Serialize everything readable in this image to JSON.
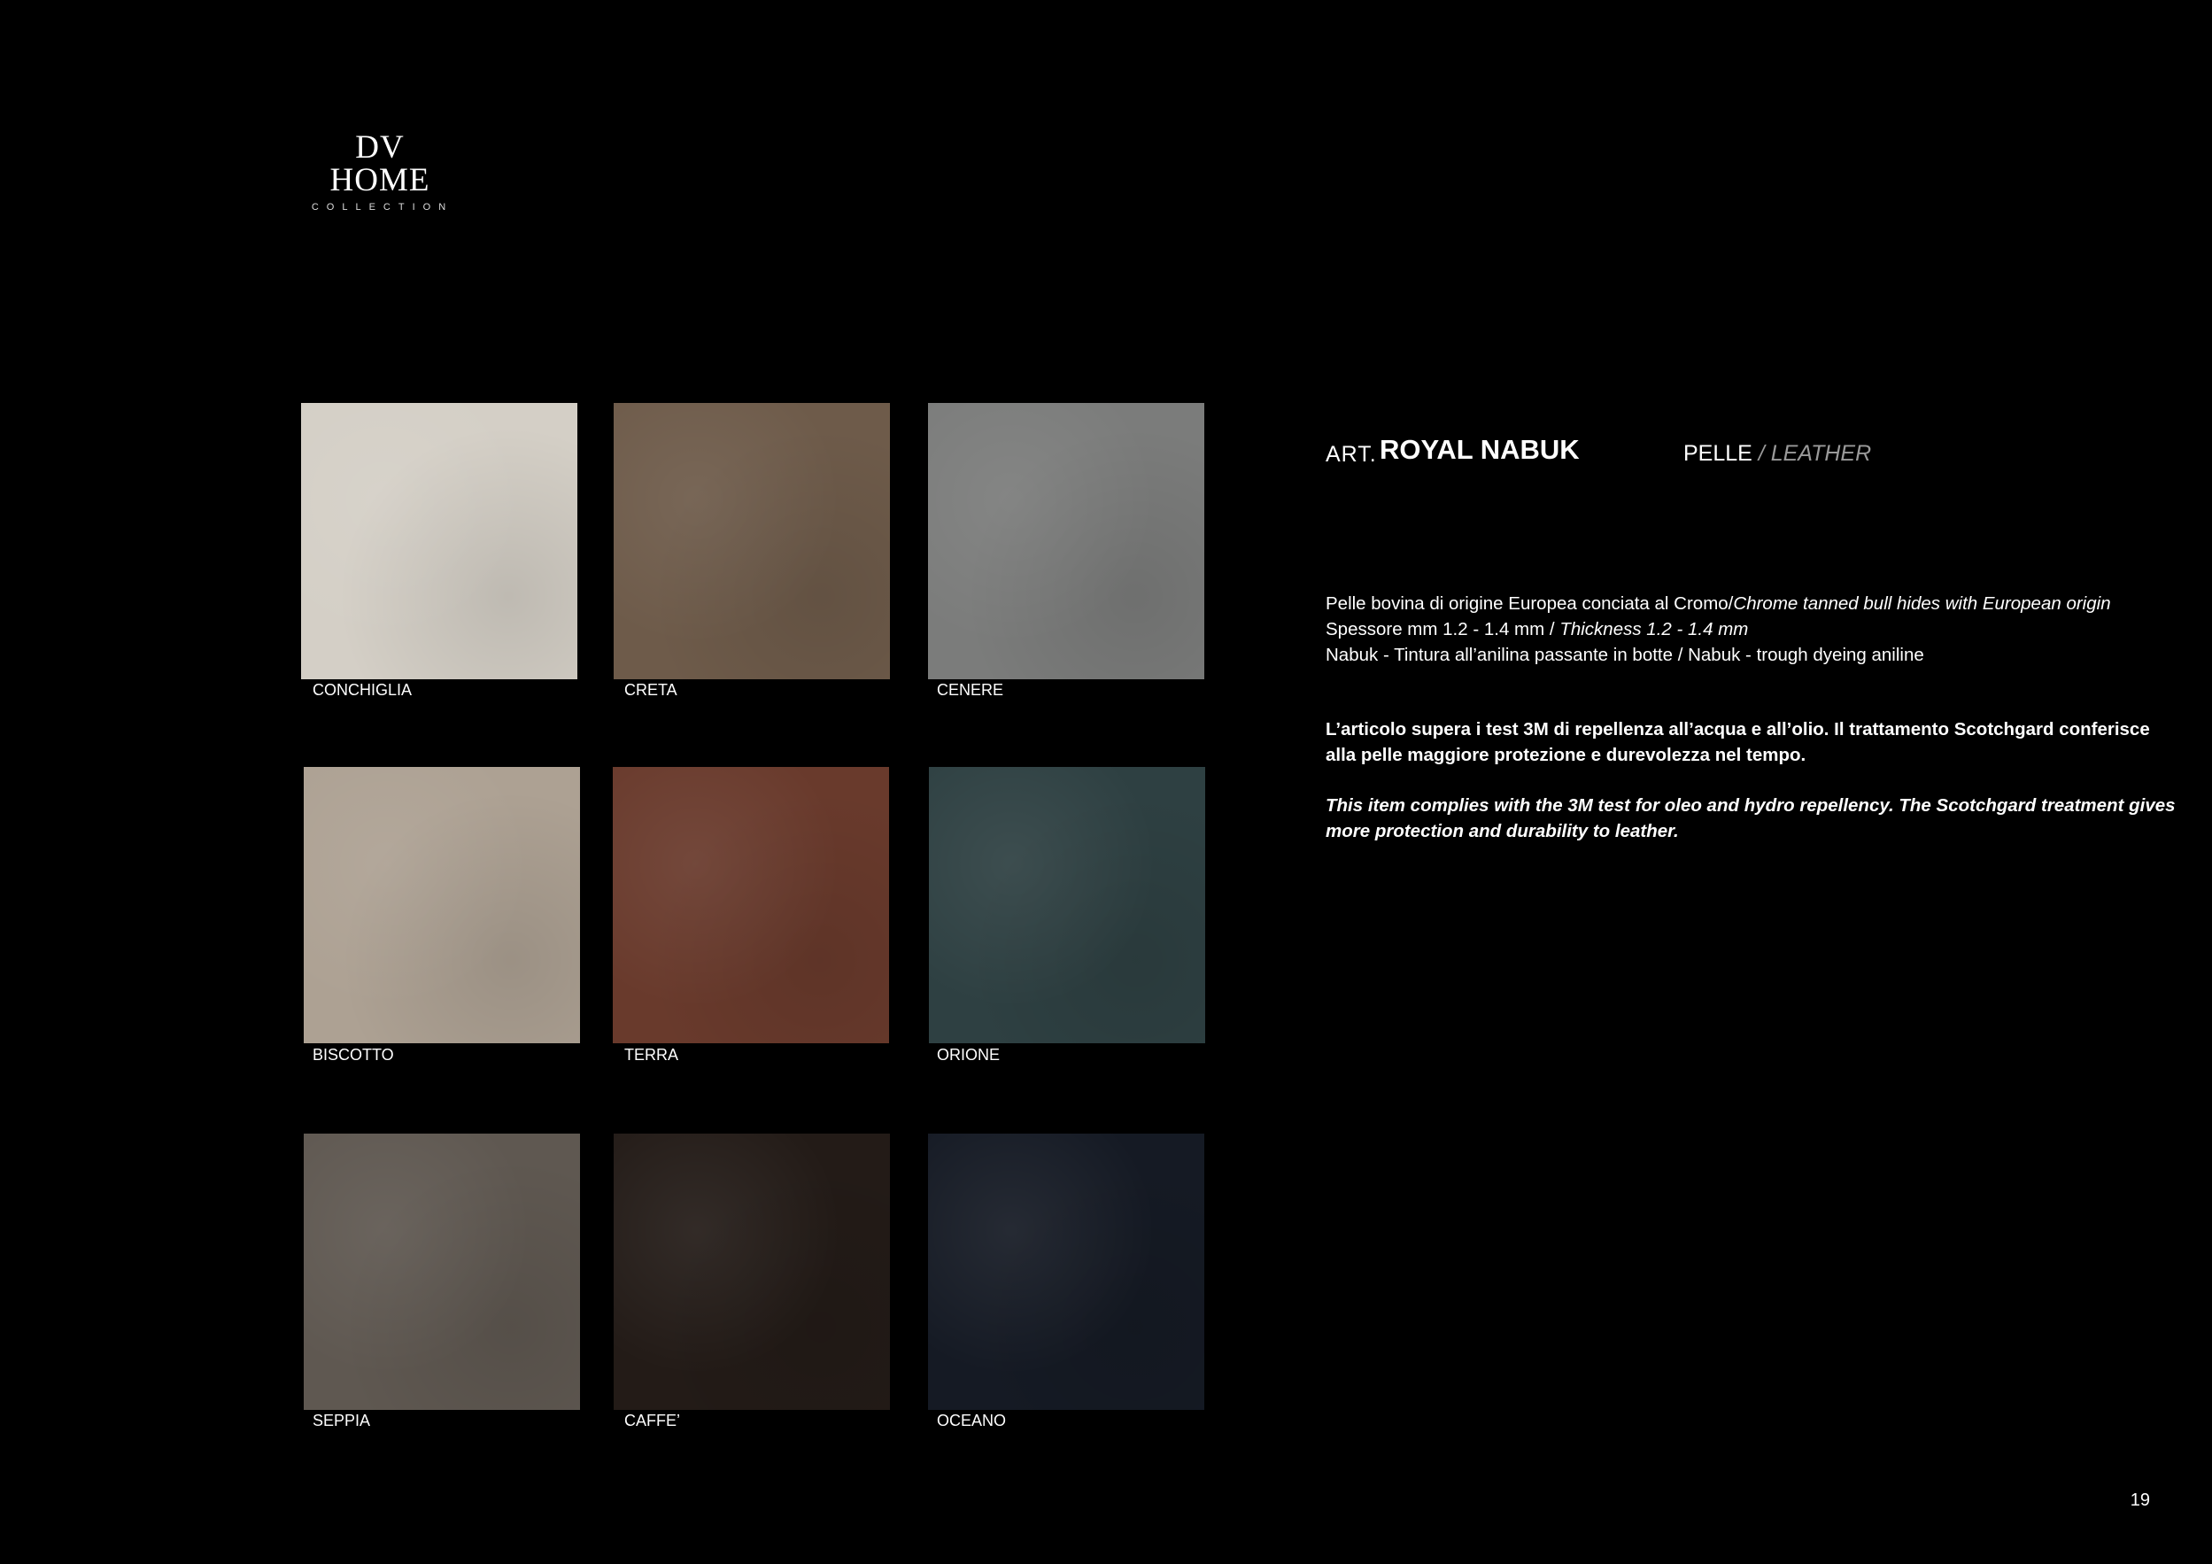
{
  "brand": {
    "name": "DV HOME",
    "subtitle": "COLLECTION"
  },
  "article": {
    "prefix": "ART.",
    "name": "ROYAL NABUK",
    "material_it": "PELLE",
    "material_sep": " / ",
    "material_en": "LEATHER"
  },
  "description": {
    "line1_it": "Pelle bovina di origine Europea conciata al Cromo/",
    "line1_en": "Chrome tanned bull hides with European origin",
    "line2_it": "Spessore mm 1.2 - 1.4 mm / ",
    "line2_en": "Thickness 1.2 - 1.4 mm",
    "line3": "Nabuk  - Tintura all’anilina passante in botte / Nabuk - trough dyeing aniline"
  },
  "treatment": {
    "it": "L’articolo supera i test 3M di repellenza all’acqua e all’olio. Il trattamento Scotchgard conferisce alla pelle maggiore protezione e durevolezza nel tempo.",
    "en": "This item complies with the 3M test for oleo and hydro repellency. The Scotchgard treatment gives more protection and durability to leather."
  },
  "swatches": [
    {
      "label": "CONCHIGLIA",
      "color": "#d4cfc6"
    },
    {
      "label": "CRETA",
      "color": "#6e5b4a"
    },
    {
      "label": "CENERE",
      "color": "#7b7c7b"
    },
    {
      "label": "BISCOTTO",
      "color": "#ada193"
    },
    {
      "label": "TERRA",
      "color": "#693a2c"
    },
    {
      "label": "ORIONE",
      "color": "#2e4042"
    },
    {
      "label": "SEPPIA",
      "color": "#5f5851"
    },
    {
      "label": "CAFFE’",
      "color": "#231b17"
    },
    {
      "label": "OCEANO",
      "color": "#151a24"
    }
  ],
  "page_number": "19"
}
